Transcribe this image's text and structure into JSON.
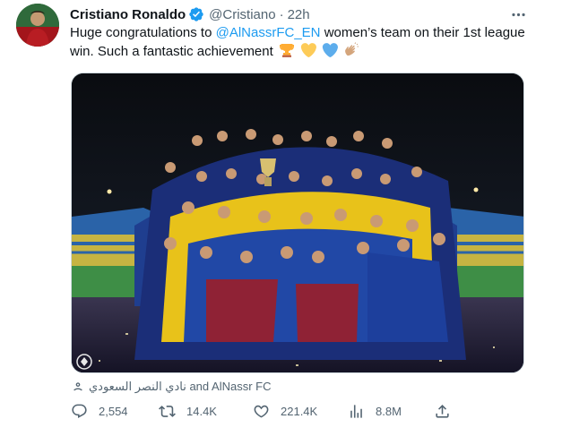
{
  "author": {
    "name": "Cristiano Ronaldo",
    "handle": "@Cristiano",
    "separator": "·",
    "time": "22h"
  },
  "tweet": {
    "text_before": "Huge congratulations to ",
    "mention": "@AlNassrFC_EN",
    "text_after": " women’s team on their 1st league win. Such a fantastic achievement",
    "emojis": [
      "trophy-icon",
      "yellow-heart-icon",
      "blue-heart-icon",
      "clapping-hands-icon"
    ]
  },
  "media": {
    "tagged_label": "نادي النصر السعودي and AlNassr FC"
  },
  "metrics": {
    "replies": "2,554",
    "retweets": "14.4K",
    "likes": "221.4K",
    "views": "8.8M"
  },
  "colors": {
    "accent": "#1d9bf0",
    "muted": "#536471",
    "text": "#0f1419",
    "verified": "#1d9bf0"
  }
}
